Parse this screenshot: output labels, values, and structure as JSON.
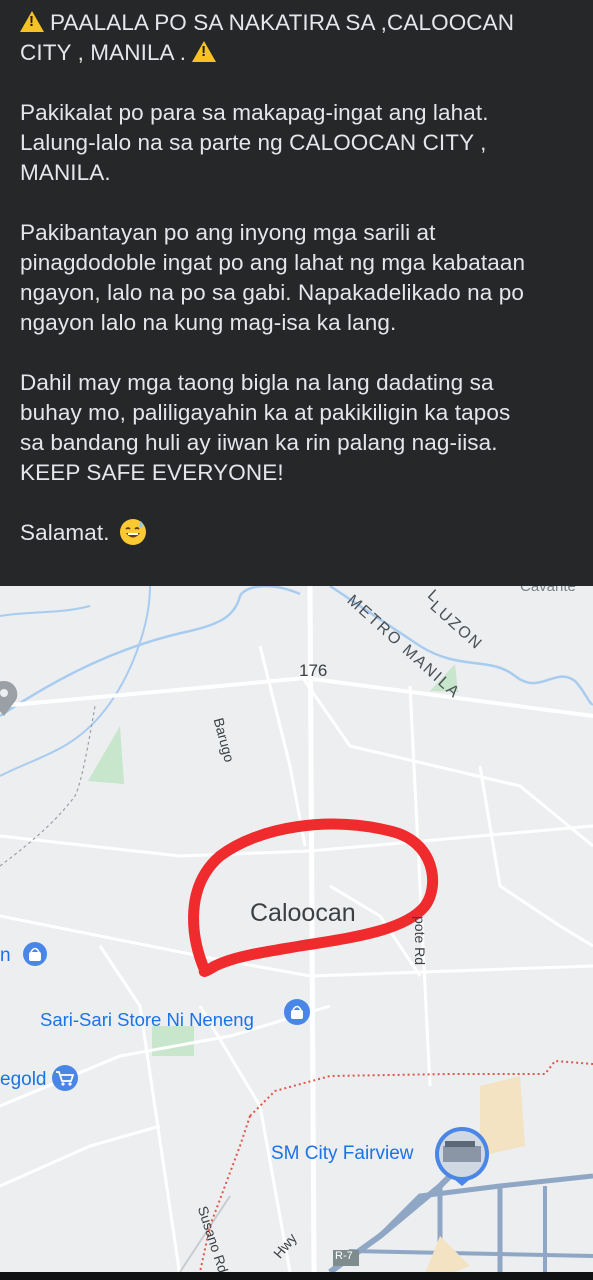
{
  "post": {
    "paragraphs": [
      [
        "PAALALA PO SA NAKATIRA SA ,CALOOCAN",
        "CITY , MANILA  ."
      ],
      [
        "Pakikalat po para sa makapag-ingat ang lahat.",
        "Lalung-lalo na sa parte ng CALOOCAN CITY ,",
        "MANILA."
      ],
      [
        "Pakibantayan po ang inyong mga sarili at",
        "pinagdodoble ingat po ang lahat ng mga kabataan",
        "ngayon, lalo na po sa gabi. Napakadelikado na po",
        "ngayon lalo na kung mag-isa ka lang."
      ],
      [
        "Dahil may mga taong bigla na lang dadating sa",
        "buhay mo, paliligayahin ka at pakikiligin ka tapos",
        "sa bandang huli ay iiwan ka rin palang nag-iisa.",
        "KEEP SAFE EVERYONE!"
      ],
      [
        "Salamat."
      ]
    ],
    "icons": [
      "warning-icon",
      "warning-icon",
      "sweat-smile-emoji"
    ]
  },
  "map": {
    "labels": {
      "region": "METRO MANILA",
      "region_partial": "LUZON",
      "region_edge": "L",
      "top_edge": "Cavante",
      "route_number": "176",
      "barugo": "Barugo",
      "city": "Caloocan",
      "road_right": "pote Rd",
      "store_left_partial": "n",
      "store": "Sari-Sari Store Ni Neneng",
      "puregold_partial": "egold",
      "mall": "SM City Fairview",
      "susano": "Susano Rd",
      "hwy": "Hwy",
      "r7": "R-7"
    },
    "colors": {
      "land": "#eceef0",
      "road": "#ffffff",
      "river": "#a8ccf0",
      "park": "#c7e6cc",
      "boundary": "#e0564b",
      "highway": "#8fa7c5",
      "circle": "#ef2b2d",
      "poi_blue": "#4a86e6"
    }
  }
}
